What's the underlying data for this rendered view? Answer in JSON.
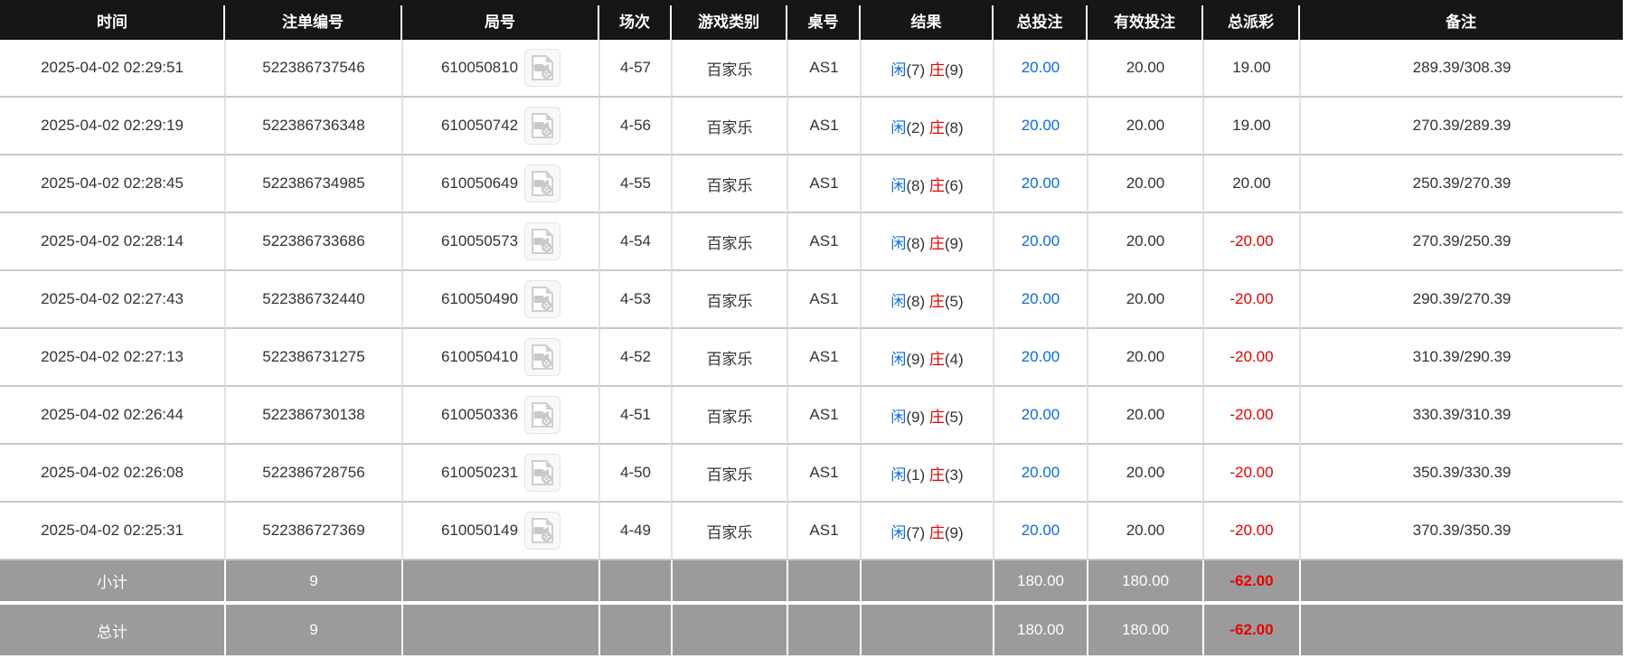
{
  "colors": {
    "header_bg": "#161616",
    "footer_bg": "#9b9b9b",
    "player_blue": "#0d6ce0",
    "banker_red": "#e80000",
    "negative_red": "#e80000"
  },
  "table": {
    "columns": [
      {
        "label": "时间"
      },
      {
        "label": "注单编号"
      },
      {
        "label": "局号"
      },
      {
        "label": "场次"
      },
      {
        "label": "游戏类别"
      },
      {
        "label": "桌号"
      },
      {
        "label": "结果"
      },
      {
        "label": "总投注"
      },
      {
        "label": "有效投注"
      },
      {
        "label": "总派彩"
      },
      {
        "label": "备注"
      }
    ],
    "rows": [
      {
        "time": "2025-04-02 02:29:51",
        "bet_id": "522386737546",
        "round": "610050810",
        "session": "4-57",
        "game_type": "百家乐",
        "table_no": "AS1",
        "result_player": "闲",
        "result_player_pts": "(7)",
        "result_banker": "庄",
        "result_banker_pts": "(9)",
        "total_bet": "20.00",
        "valid_bet": "20.00",
        "payout": "19.00",
        "payout_sign": "pos",
        "remark": "289.39/308.39"
      },
      {
        "time": "2025-04-02 02:29:19",
        "bet_id": "522386736348",
        "round": "610050742",
        "session": "4-56",
        "game_type": "百家乐",
        "table_no": "AS1",
        "result_player": "闲",
        "result_player_pts": "(2)",
        "result_banker": "庄",
        "result_banker_pts": "(8)",
        "total_bet": "20.00",
        "valid_bet": "20.00",
        "payout": "19.00",
        "payout_sign": "pos",
        "remark": "270.39/289.39"
      },
      {
        "time": "2025-04-02 02:28:45",
        "bet_id": "522386734985",
        "round": "610050649",
        "session": "4-55",
        "game_type": "百家乐",
        "table_no": "AS1",
        "result_player": "闲",
        "result_player_pts": "(8)",
        "result_banker": "庄",
        "result_banker_pts": "(6)",
        "total_bet": "20.00",
        "valid_bet": "20.00",
        "payout": "20.00",
        "payout_sign": "pos",
        "remark": "250.39/270.39"
      },
      {
        "time": "2025-04-02 02:28:14",
        "bet_id": "522386733686",
        "round": "610050573",
        "session": "4-54",
        "game_type": "百家乐",
        "table_no": "AS1",
        "result_player": "闲",
        "result_player_pts": "(8)",
        "result_banker": "庄",
        "result_banker_pts": "(9)",
        "total_bet": "20.00",
        "valid_bet": "20.00",
        "payout": "-20.00",
        "payout_sign": "neg",
        "remark": "270.39/250.39"
      },
      {
        "time": "2025-04-02 02:27:43",
        "bet_id": "522386732440",
        "round": "610050490",
        "session": "4-53",
        "game_type": "百家乐",
        "table_no": "AS1",
        "result_player": "闲",
        "result_player_pts": "(8)",
        "result_banker": "庄",
        "result_banker_pts": "(5)",
        "total_bet": "20.00",
        "valid_bet": "20.00",
        "payout": "-20.00",
        "payout_sign": "neg",
        "remark": "290.39/270.39"
      },
      {
        "time": "2025-04-02 02:27:13",
        "bet_id": "522386731275",
        "round": "610050410",
        "session": "4-52",
        "game_type": "百家乐",
        "table_no": "AS1",
        "result_player": "闲",
        "result_player_pts": "(9)",
        "result_banker": "庄",
        "result_banker_pts": "(4)",
        "total_bet": "20.00",
        "valid_bet": "20.00",
        "payout": "-20.00",
        "payout_sign": "neg",
        "remark": "310.39/290.39"
      },
      {
        "time": "2025-04-02 02:26:44",
        "bet_id": "522386730138",
        "round": "610050336",
        "session": "4-51",
        "game_type": "百家乐",
        "table_no": "AS1",
        "result_player": "闲",
        "result_player_pts": "(9)",
        "result_banker": "庄",
        "result_banker_pts": "(5)",
        "total_bet": "20.00",
        "valid_bet": "20.00",
        "payout": "-20.00",
        "payout_sign": "neg",
        "remark": "330.39/310.39"
      },
      {
        "time": "2025-04-02 02:26:08",
        "bet_id": "522386728756",
        "round": "610050231",
        "session": "4-50",
        "game_type": "百家乐",
        "table_no": "AS1",
        "result_player": "闲",
        "result_player_pts": "(1)",
        "result_banker": "庄",
        "result_banker_pts": "(3)",
        "total_bet": "20.00",
        "valid_bet": "20.00",
        "payout": "-20.00",
        "payout_sign": "neg",
        "remark": "350.39/330.39"
      },
      {
        "time": "2025-04-02 02:25:31",
        "bet_id": "522386727369",
        "round": "610050149",
        "session": "4-49",
        "game_type": "百家乐",
        "table_no": "AS1",
        "result_player": "闲",
        "result_player_pts": "(7)",
        "result_banker": "庄",
        "result_banker_pts": "(9)",
        "total_bet": "20.00",
        "valid_bet": "20.00",
        "payout": "-20.00",
        "payout_sign": "neg",
        "remark": "370.39/350.39"
      }
    ],
    "footer": {
      "subtotal": {
        "label": "小计",
        "count": "9",
        "total_bet": "180.00",
        "valid_bet": "180.00",
        "payout": "-62.00",
        "payout_sign": "neg"
      },
      "total": {
        "label": "总计",
        "count": "9",
        "total_bet": "180.00",
        "valid_bet": "180.00",
        "payout": "-62.00",
        "payout_sign": "neg"
      }
    }
  }
}
